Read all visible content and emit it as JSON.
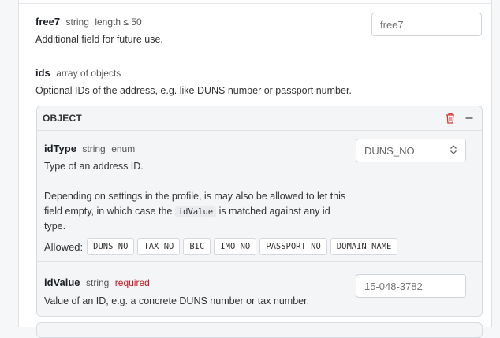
{
  "free7": {
    "name": "free7",
    "type": "string",
    "constraint": "length ≤ 50",
    "description": "Additional field for future use.",
    "placeholder": "free7"
  },
  "ids": {
    "name": "ids",
    "type": "array of objects",
    "description": "Optional IDs of the address, e.g. like DUNS number or passport number.",
    "object": {
      "title": "OBJECT",
      "delete_icon": "trash-icon",
      "collapse_icon": "minus-icon",
      "idType": {
        "name": "idType",
        "type": "string",
        "enum": "enum",
        "description": "Type of an address ID.",
        "detail_before": "Depending on settings in the profile, is may also be allowed to let this field empty, in which case the",
        "detail_code": "idValue",
        "detail_after": "is matched against any id type.",
        "select_value": "DUNS_NO",
        "allowed_label": "Allowed:",
        "allowed": [
          "DUNS_NO",
          "TAX_NO",
          "BIC",
          "IMO_NO",
          "PASSPORT_NO",
          "DOMAIN_NAME"
        ]
      },
      "idValue": {
        "name": "idValue",
        "type": "string",
        "required": "required",
        "description": "Value of an ID, e.g. a concrete DUNS number or tax number.",
        "placeholder": "15-048-3782"
      }
    }
  },
  "colors": {
    "required": "#c3151c",
    "delete_icon": "#d63b3b"
  }
}
